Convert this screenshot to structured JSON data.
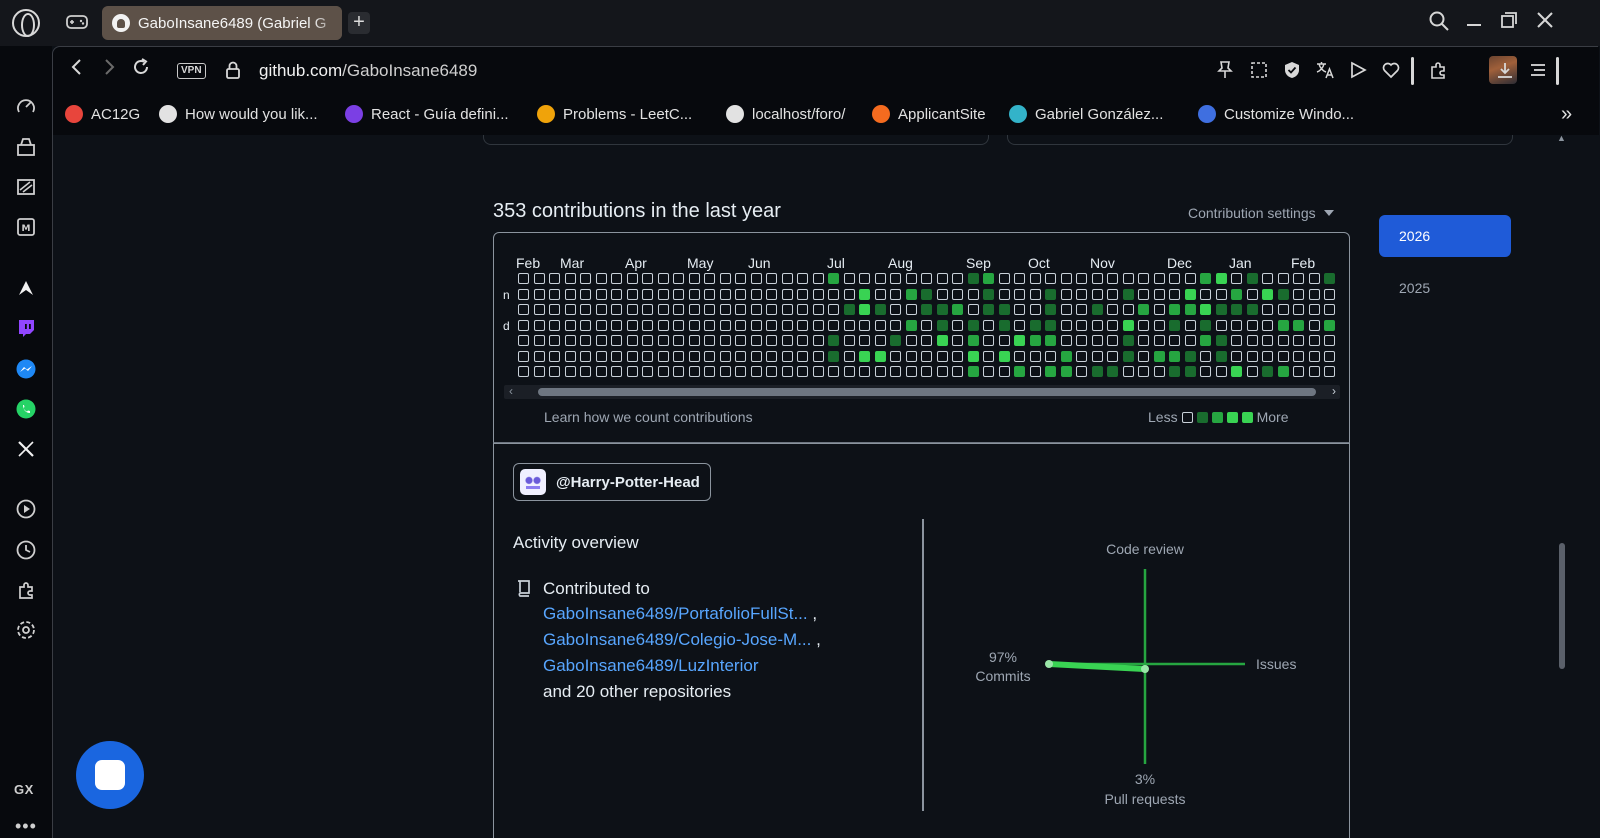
{
  "tab": {
    "title": "GaboInsane6489 (Gabriel G"
  },
  "address": {
    "vpn": "VPN",
    "host": "github.com",
    "path": "/GaboInsane6489"
  },
  "bookmarks": [
    {
      "label": "AC12G",
      "color": "#e8453c"
    },
    {
      "label": "How would you lik...",
      "color": "#e2e2e2"
    },
    {
      "label": "React - Guía defini...",
      "color": "#7b3fe4"
    },
    {
      "label": "Problems - LeetC...",
      "color": "#f0a30a"
    },
    {
      "label": "localhost/foro/",
      "color": "#e2e2e2"
    },
    {
      "label": "ApplicantSite",
      "color": "#f46b1f"
    },
    {
      "label": "Gabriel González...",
      "color": "#33b3c9"
    },
    {
      "label": "Customize Windo...",
      "color": "#3f6fe0"
    }
  ],
  "contributions": {
    "title": "353 contributions in the last year",
    "settings_label": "Contribution settings",
    "months": [
      "Feb",
      "Mar",
      "Apr",
      "May",
      "Jun",
      "Jul",
      "Aug",
      "Sep",
      "Oct",
      "Nov",
      "Dec",
      "Jan",
      "Feb"
    ],
    "day_labels": [
      "n",
      "d"
    ],
    "learn_label": "Learn how we count contributions",
    "legend_less": "Less",
    "legend_more": "More",
    "weeks": 53,
    "active_from_week": 19,
    "colors": {
      "empty_border": "#c9d1d9",
      "l1": "#196c2e",
      "l2": "#26a641",
      "l3": "#39d353"
    }
  },
  "activity": {
    "org": "@Harry-Potter-Head",
    "overview_title": "Activity overview",
    "contributed_to": "Contributed to",
    "repos": [
      "GaboInsane6489/PortafolioFullSt...",
      "GaboInsane6489/Colegio-Jose-M...",
      "GaboInsane6489/LuzInterior"
    ],
    "repo_sep": ",",
    "others": "and 20 other repositories",
    "chart": {
      "code_review": "Code review",
      "issues": "Issues",
      "commits_pct": "97%",
      "commits": "Commits",
      "pr_pct": "3%",
      "pull_requests": "Pull requests"
    }
  },
  "years": {
    "selected": "2026",
    "other": "2025"
  },
  "sidebar": {
    "gx": "GX",
    "more": "•••"
  }
}
